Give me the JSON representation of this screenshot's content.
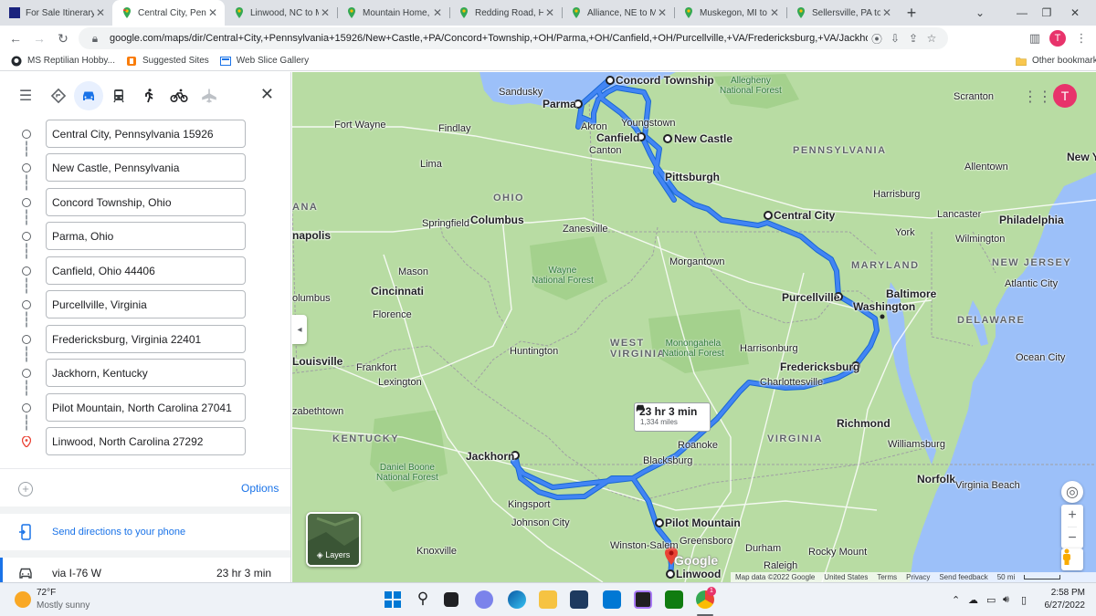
{
  "tabs": [
    {
      "label": "For Sale Itinerary",
      "favicon": "#1a237e"
    },
    {
      "label": "Central City, Penn",
      "favicon": "maps"
    },
    {
      "label": "Linwood, NC to M",
      "favicon": "maps"
    },
    {
      "label": "Mountain Home,",
      "favicon": "maps"
    },
    {
      "label": "Redding Road, He",
      "favicon": "maps"
    },
    {
      "label": "Alliance, NE to M",
      "favicon": "maps"
    },
    {
      "label": "Muskegon, MI to",
      "favicon": "maps"
    },
    {
      "label": "Sellersville, PA to",
      "favicon": "maps"
    }
  ],
  "address_bar": {
    "url": "google.com/maps/dir/Central+City,+Pennsylvania+15926/New+Castle,+PA/Concord+Township,+OH/Parma,+OH/Canfield,+OH/Purcellville,+VA/Fredericksburg,+VA/Jackhorn,+KY/Pilot..."
  },
  "profile": {
    "initial": "T"
  },
  "bookmarks": [
    {
      "label": "MS Reptilian Hobby..."
    },
    {
      "label": "Suggested Sites"
    },
    {
      "label": "Web Slice Gallery"
    }
  ],
  "other_bookmarks": "Other bookmarks",
  "directions": {
    "stops": [
      "Central City, Pennsylvania 15926",
      "New Castle, Pennsylvania",
      "Concord Township, Ohio",
      "Parma, Ohio",
      "Canfield, Ohio 44406",
      "Purcellville, Virginia",
      "Fredericksburg, Virginia 22401",
      "Jackhorn, Kentucky",
      "Pilot Mountain, North Carolina 27041",
      "Linwood, North Carolina 27292"
    ],
    "options_label": "Options",
    "send_label": "Send directions to your phone",
    "route_name": "via I-76 W",
    "route_time": "23 hr 3 min"
  },
  "map": {
    "route_time": "23 hr 3 min",
    "route_distance": "1,334 miles",
    "layers_label": "Layers",
    "google_logo": "Google",
    "footer": [
      "Map data ©2022 Google",
      "United States",
      "Terms",
      "Privacy",
      "Send feedback",
      "50 mi"
    ],
    "labels": {
      "sandusky": "Sandusky",
      "parma": "Parma",
      "concord": "Concord Township",
      "allegheny": "Allegheny\nNational Forest",
      "scranton": "Scranton",
      "fortwayne": "Fort Wayne",
      "findlay": "Findlay",
      "akron": "Akron",
      "youngstown": "Youngstown",
      "canfield": "Canfield",
      "newcastle": "New Castle",
      "canton": "Canton",
      "pennsylvania": "PENNSYLVANIA",
      "allentown": "Allentown",
      "newyork": "New Yo",
      "lima": "Lima",
      "pittsburgh": "Pittsburgh",
      "ohio": "OHIO",
      "harrisburg": "Harrisburg",
      "indiana": "ANA",
      "springfield": "Springfield",
      "columbus": "Columbus",
      "centralcity": "Central City",
      "lancaster": "Lancaster",
      "philadelphia": "Philadelphia",
      "napolis": "napolis",
      "zanesville": "Zanesville",
      "york": "York",
      "wilmington": "Wilmington",
      "morgantown": "Morgantown",
      "maryland": "MARYLAND",
      "newjersey": "NEW JERSEY",
      "mason": "Mason",
      "wayne": "Wayne\nNational Forest",
      "cincinnati": "Cincinnati",
      "purcellville": "Purcellville",
      "baltimore": "Baltimore",
      "atlanticcity": "Atlantic City",
      "olumbus": "olumbus",
      "florence": "Florence",
      "washington": "Washington",
      "delaware": "DELAWARE",
      "westvirginia": "WEST\nVIRGINIA",
      "monongahela": "Monongahela\nNational Forest",
      "huntington": "Huntington",
      "harrisonburg": "Harrisonburg",
      "louisville": "Louisville",
      "frankfort": "Frankfort",
      "fredericksburg": "Fredericksburg",
      "oceancity": "Ocean City",
      "lexington": "Lexington",
      "charlottesville": "Charlottesville",
      "zabethtown": "zabethtown",
      "richmond": "Richmond",
      "kentucky": "KENTUCKY",
      "virginia": "VIRGINIA",
      "roanoke": "Roanoke",
      "williamsburg": "Williamsburg",
      "danielboone": "Daniel Boone\nNational Forest",
      "jackhorn": "Jackhorn",
      "blacksburg": "Blacksburg",
      "norfolk": "Norfolk",
      "virginiabeach": "Virginia Beach",
      "kingsport": "Kingsport",
      "johnsoncity": "Johnson City",
      "pilotmountain": "Pilot Mountain",
      "knoxville": "Knoxville",
      "greensboro": "Greensboro",
      "winstonsalem": "Winston-Salem",
      "durham": "Durham",
      "rockymount": "Rocky Mount",
      "raleigh": "Raleigh",
      "linwood": "Linwood"
    }
  },
  "weather": {
    "temp": "72°F",
    "desc": "Mostly sunny"
  },
  "clock": {
    "time": "2:58 PM",
    "date": "6/27/2022"
  },
  "colors": {
    "route": "#4285f4",
    "route_edge": "#1967d2",
    "map_land": "#b8dca3",
    "water": "#9cc0f9",
    "panel_accent": "#1a73e8"
  }
}
